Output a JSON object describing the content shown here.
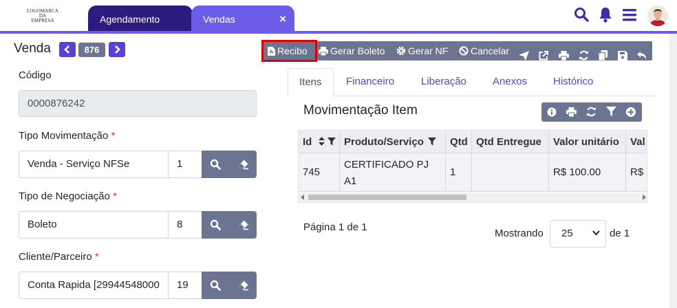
{
  "header": {
    "logo_lines": [
      "LOGOMARCA",
      "DA",
      "EMPRESA"
    ],
    "tabs": [
      {
        "label": "Agendamento"
      },
      {
        "label": "Vendas",
        "close": "×"
      }
    ]
  },
  "form": {
    "title": "Venda",
    "record_number": "876",
    "codigo": {
      "label": "Código",
      "value": "0000876242"
    },
    "tipo_movimentacao": {
      "label": "Tipo Movimentação",
      "required_mark": "*",
      "value": "Venda - Serviço NFSe",
      "code": "1"
    },
    "tipo_negociacao": {
      "label": "Tipo de Negociação",
      "required_mark": "*",
      "value": "Boleto",
      "code": "8"
    },
    "cliente_parceiro": {
      "label": "Cliente/Parceiro",
      "required_mark": "*",
      "value": "Conta Rapida [29944548000",
      "code": "19"
    }
  },
  "toolbar": {
    "recibo": "Recibo",
    "gerar_boleto": "Gerar Boleto",
    "gerar_nf": "Gerar NF",
    "cancelar": "Cancelar"
  },
  "detail_tabs": [
    "Itens",
    "Financeiro",
    "Liberação",
    "Anexos",
    "Histórico"
  ],
  "items_panel": {
    "title": "Movimentação Item",
    "columns": [
      "Id",
      "Produto/Serviço",
      "Qtd",
      "Qtd Entregue",
      "Valor unitário",
      "Val"
    ],
    "rows": [
      {
        "id": "745",
        "produto_line1": "CERTIFICADO PJ",
        "produto_line2": "A1",
        "qtd": "1",
        "qtd_entregue": "",
        "valor_unitario": "R$ 100.00",
        "valor": "R$"
      }
    ]
  },
  "pagination": {
    "page_text": "Página 1 de 1",
    "showing_label": "Mostrando",
    "page_size": "25",
    "of_text": "de 1"
  },
  "colors": {
    "brand_dark": "#2e1b7f",
    "brand": "#6c5ce7",
    "toolbar_gray": "#6b7490",
    "highlight_red": "#e00000"
  }
}
